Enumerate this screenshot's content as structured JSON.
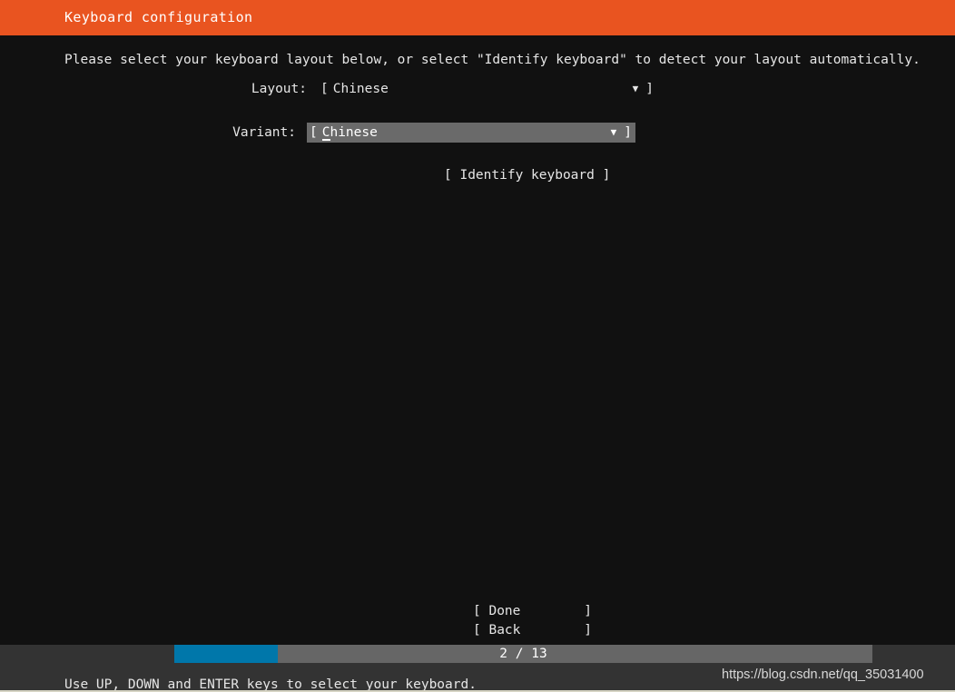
{
  "header": {
    "title": "Keyboard configuration",
    "accent_color": "#e95420"
  },
  "body": {
    "intro": "Please select your keyboard layout below, or select \"Identify keyboard\" to detect your layout automatically.",
    "background_color": "#111111"
  },
  "form": {
    "layout": {
      "label": "Layout:",
      "bracket_open": "[",
      "value": "Chinese",
      "arrow": "▼",
      "bracket_close": "]",
      "focused": false
    },
    "variant": {
      "label": "Variant:",
      "bracket_open": "[",
      "value": "Chinese",
      "arrow": "▼",
      "bracket_close": "]",
      "focused": true,
      "highlight_color": "#6a6a6a"
    }
  },
  "actions": {
    "identify": "[ Identify keyboard ]",
    "done": "[ Done        ]",
    "back": "[ Back        ]"
  },
  "footer": {
    "progress_text": "2 / 13",
    "progress_current": 2,
    "progress_total": 13,
    "progress_fill_color": "#0077aa",
    "progress_track_color": "#666666",
    "hint": "Use UP, DOWN and ENTER keys to select your keyboard."
  },
  "watermark": {
    "text": "https://blog.csdn.net/qq_35031400"
  }
}
